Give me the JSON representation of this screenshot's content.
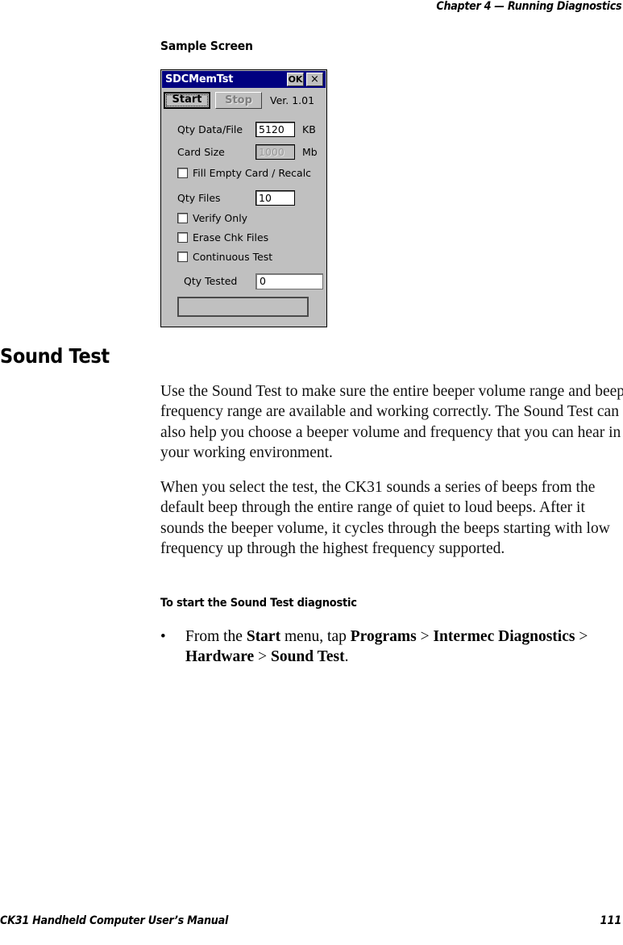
{
  "page": {
    "running_head": "Chapter 4 — Running Diagnostics",
    "footer_left": "CK31 Handheld Computer User’s Manual",
    "footer_right": "111"
  },
  "headings": {
    "sample_screen": "Sample Screen",
    "section": "Sound Test",
    "procedure": "To start the Sound Test diagnostic"
  },
  "paragraphs": {
    "p1": "Use the Sound Test to make sure the entire beeper volume range and beep frequency range are available and working correctly. The Sound Test can also help you choose a beeper volume and frequency that you can hear in your working environment.",
    "p2": "When you select the test, the CK31 sounds a series of beeps from the default beep through the entire range of quiet to loud beeps. After it sounds the beeper volume, it cycles through the beeps starting with low frequency up through the highest frequency supported."
  },
  "bullet": {
    "marker": "•",
    "seg1": "From the ",
    "b1": "Start",
    "seg2": " menu, tap ",
    "b2": "Programs",
    "sep1": " > ",
    "b3": "Intermec Diagnostics",
    "sep2": " > ",
    "b4": "Hardware",
    "sep3": " > ",
    "b5": "Sound Test",
    "end": "."
  },
  "dialog": {
    "title": "SDCMemTst",
    "ok_button": "OK",
    "close_button": "×",
    "start_button": "Start",
    "stop_button": "Stop",
    "version": "Ver. 1.01",
    "fields": {
      "qty_data_file_label": "Qty Data/File",
      "qty_data_file_value": "5120",
      "qty_data_file_unit": "KB",
      "card_size_label": "Card Size",
      "card_size_value": "1000",
      "card_size_unit": "Mb",
      "qty_files_label": "Qty Files",
      "qty_files_value": "10",
      "qty_tested_label": "Qty Tested",
      "qty_tested_value": "0",
      "status_value": ""
    },
    "checkboxes": [
      {
        "label": "Fill Empty Card / Recalc",
        "checked": false
      },
      {
        "label": "Verify Only",
        "checked": false
      },
      {
        "label": "Erase Chk Files",
        "checked": false
      },
      {
        "label": "Continuous Test",
        "checked": false
      }
    ],
    "colors": {
      "titlebar": "#000080",
      "face": "#c0c0c0",
      "field": "#ffffff",
      "disabled_text": "#9a9a9a"
    }
  }
}
